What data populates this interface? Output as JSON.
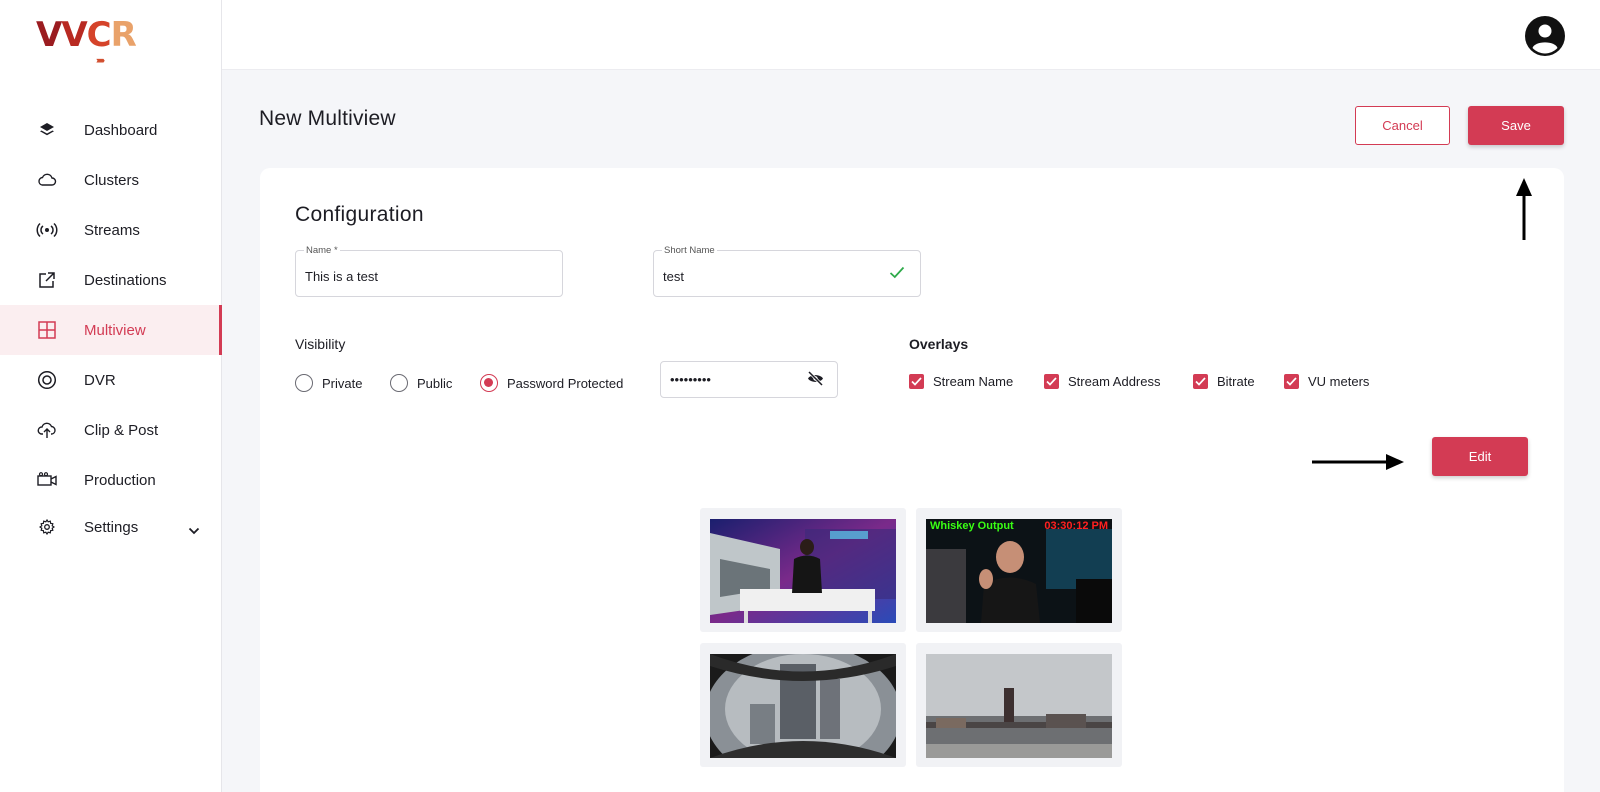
{
  "brand": {
    "logo_text": "VVCR"
  },
  "sidebar": {
    "items": [
      {
        "label": "Dashboard",
        "icon": "layers-icon",
        "active": false
      },
      {
        "label": "Clusters",
        "icon": "cloud-icon",
        "active": false
      },
      {
        "label": "Streams",
        "icon": "broadcast-icon",
        "active": false
      },
      {
        "label": "Destinations",
        "icon": "external-link-icon",
        "active": false
      },
      {
        "label": "Multiview",
        "icon": "grid-icon",
        "active": true
      },
      {
        "label": "DVR",
        "icon": "record-icon",
        "active": false
      },
      {
        "label": "Clip & Post",
        "icon": "cloud-upload-icon",
        "active": false
      },
      {
        "label": "Production",
        "icon": "video-camera-icon",
        "active": false
      },
      {
        "label": "Settings",
        "icon": "gear-icon",
        "active": false
      }
    ]
  },
  "header": {
    "avatar_icon": "user-avatar-icon"
  },
  "page": {
    "title": "New Multiview",
    "cancel_label": "Cancel",
    "save_label": "Save"
  },
  "configuration": {
    "title": "Configuration",
    "name_label": "Name *",
    "name_value": "This is a test",
    "short_name_label": "Short Name",
    "short_name_value": "test",
    "visibility_label": "Visibility",
    "visibility_options": [
      "Private",
      "Public",
      "Password Protected"
    ],
    "visibility_selected": "Password Protected",
    "password_value": "•••••••••",
    "overlays_label": "Overlays",
    "overlays": [
      "Stream Name",
      "Stream Address",
      "Bitrate",
      "VU meters"
    ],
    "edit_label": "Edit"
  },
  "preview": {
    "tile2_overlay_left": "Whiskey Output",
    "tile2_overlay_right": "03:30:12 PM"
  },
  "colors": {
    "accent": "#d33b54",
    "active_bg": "#fbeef0"
  }
}
